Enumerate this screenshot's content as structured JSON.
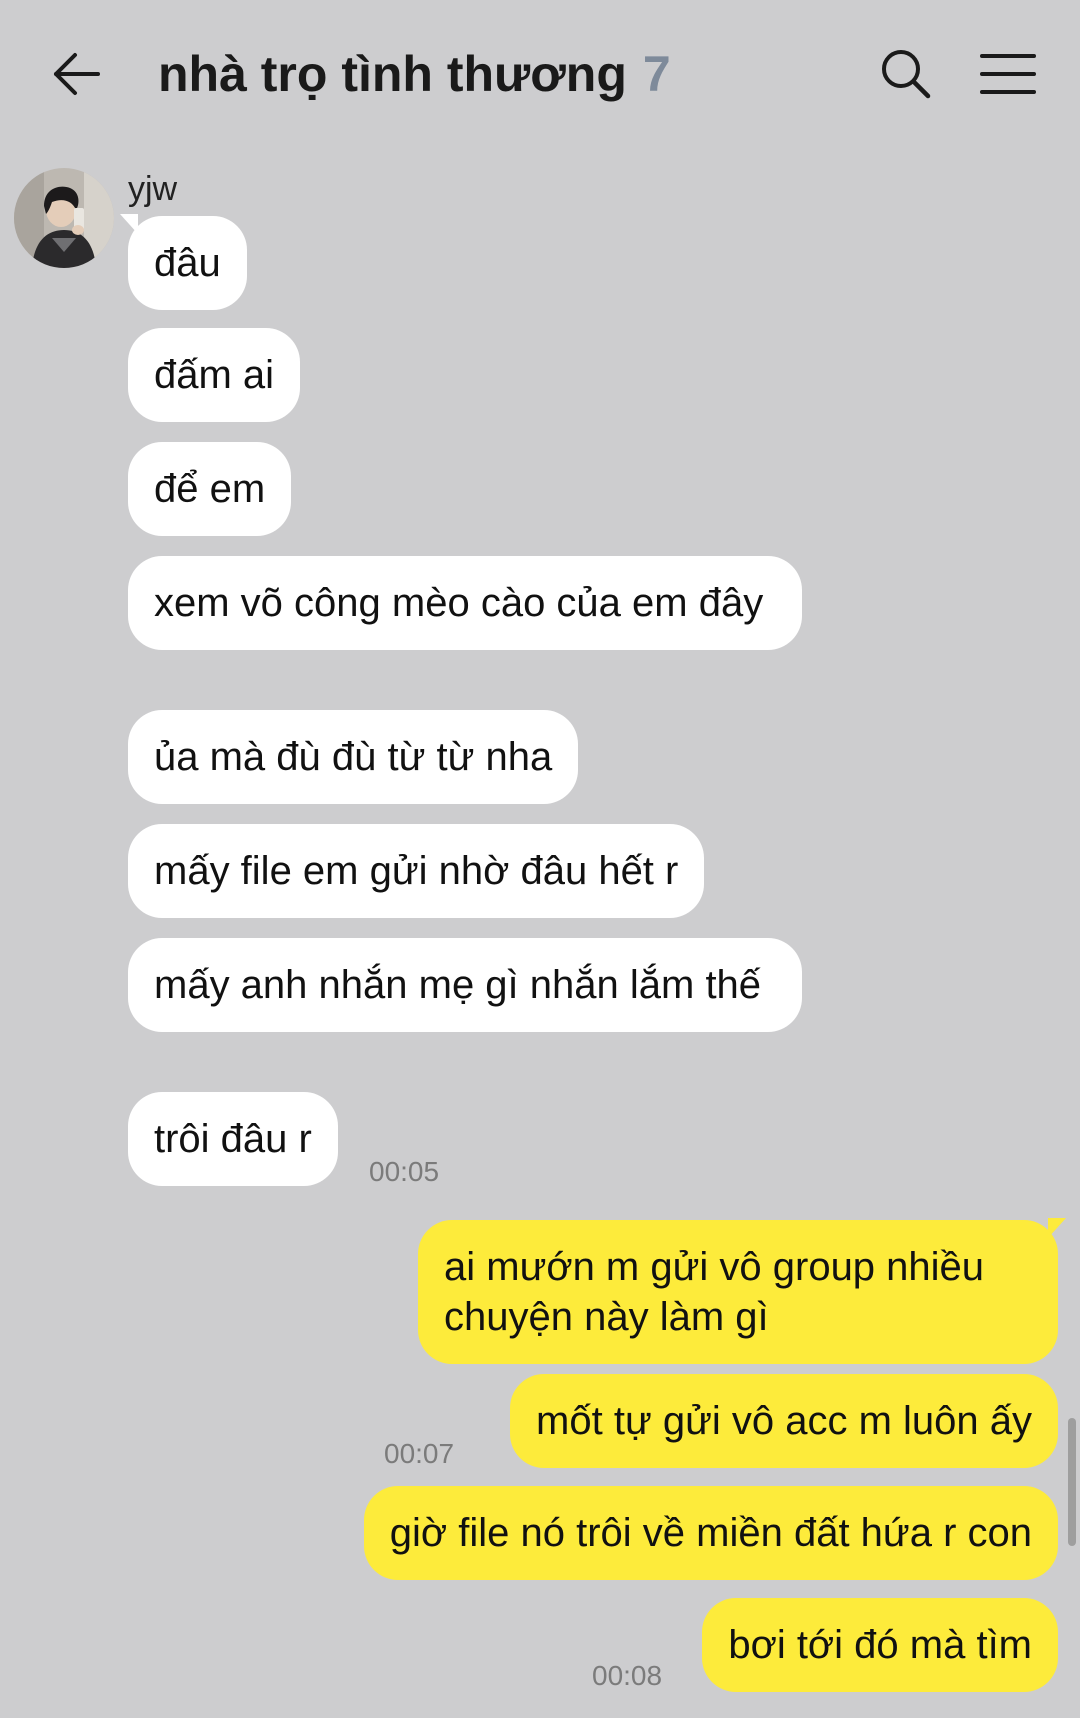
{
  "header": {
    "title": "nhà trọ tình thương",
    "member_count": "7",
    "back_icon": "arrow-left-icon",
    "search_icon": "search-icon",
    "menu_icon": "hamburger-menu-icon"
  },
  "sender": {
    "name": "yjw"
  },
  "incoming_messages": [
    "đâu",
    "đấm ai",
    "để em",
    "xem võ công mèo cào của em đây",
    "ủa mà đù đù từ từ nha",
    "mấy file em gửi nhờ đâu hết r",
    "mấy anh nhắn mẹ gì nhắn lắm thế",
    "trôi đâu r"
  ],
  "incoming_time": "00:05",
  "outgoing_messages": [
    "ai mướn m gửi vô group nhiều chuyện này làm gì",
    "mốt tự gửi vô acc m luôn ấy",
    "giờ file nó trôi về miền đất hứa r con",
    "bơi tới đó mà tìm"
  ],
  "outgoing_times": [
    "00:07",
    "00:08"
  ],
  "colors": {
    "background": "#cdcdcf",
    "incoming_bubble": "#ffffff",
    "outgoing_bubble": "#fdeb3b",
    "member_count": "#7e8a9a"
  }
}
